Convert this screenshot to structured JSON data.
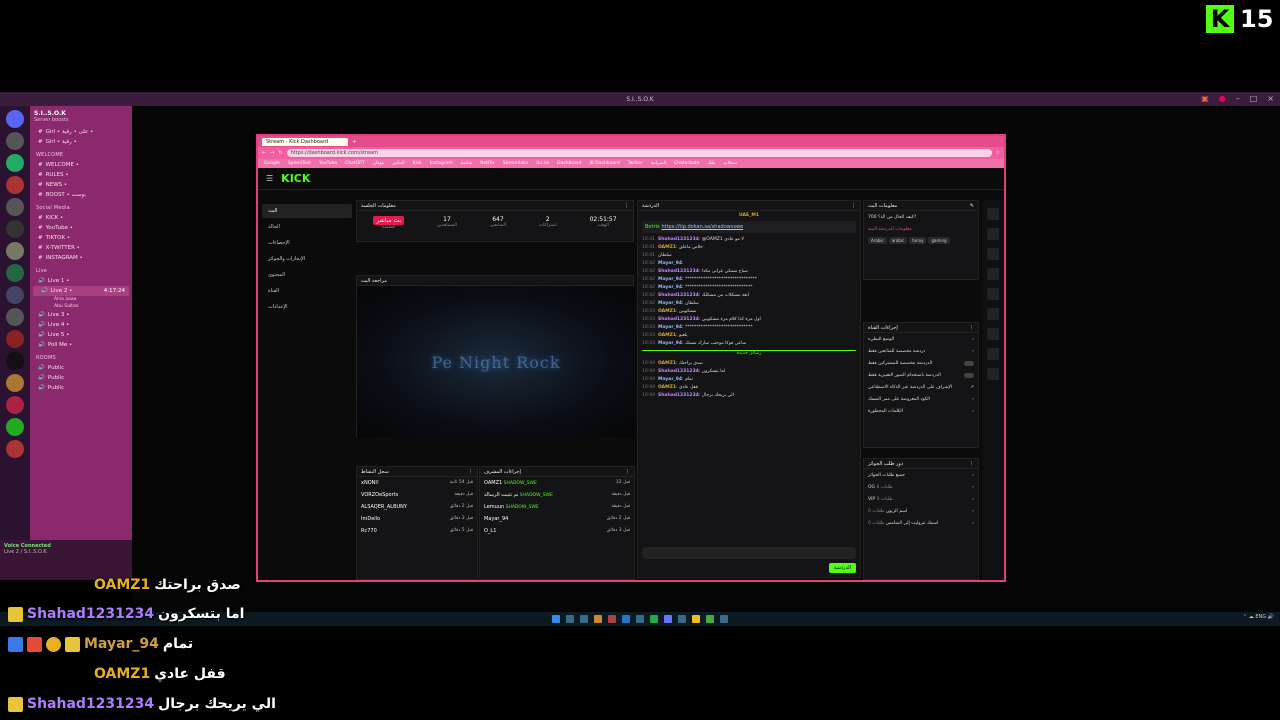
{
  "badge": {
    "logo": "K",
    "count": "15"
  },
  "discord": {
    "window_title": "S.I..S.O.K",
    "server_name": "S.I..S.O.K",
    "server_sub": "Server boosts",
    "channels": [
      {
        "label": "Girl • على • رقية •",
        "type": "text"
      },
      {
        "label": "Girl • رقية •",
        "type": "text"
      }
    ],
    "categories": [
      "WELCOME",
      "Social Media",
      "Live",
      "ROOMS"
    ],
    "welcome_channels": [
      "WELCOME •",
      "RULES •",
      "NEWS •",
      "BOOST • بوست"
    ],
    "social_channels": [
      "KICK •",
      "YouTube •",
      "TIKTOK •",
      "X-TWITTER •",
      "INSTAGRAM •"
    ],
    "live_channels": [
      "Live 1 •",
      "Live 2 •",
      "Live 3 •",
      "Live 4 •",
      "Live 5 •",
      "Poll Me •"
    ],
    "live2_time": "4:17:24",
    "live2_users": [
      "Alna aaaa",
      "Abu Sultan"
    ],
    "rooms": [
      "Public",
      "Public",
      "Public"
    ],
    "voice_status": "Voice Connected",
    "voice_sub": "Live 2 / S.I..S.O.K"
  },
  "browser": {
    "tab_label": "Stream - Kick Dashboard",
    "url": "https://dashboard.kick.com/stream",
    "bookmarks": [
      "Google",
      "SpeedTest",
      "YouTube",
      "ChatGPT",
      "بنوفان",
      "التباس",
      "Kick",
      "Instagram",
      "شاشة",
      "Netflix",
      "Streamlabs",
      "ikz.sa",
      "Dashboard",
      "JB Dashboard",
      "Twitter",
      "الميزانية",
      "Chaturbate",
      "ملك",
      "سجلات"
    ]
  },
  "kick": {
    "logo": "KICK",
    "nav": [
      "البث",
      "الحالة",
      "الإحصاءات",
      "الإنجازات والجوائز",
      "المحتوى",
      "القناة",
      "الإعدادات"
    ],
    "stats_title": "معلومات الجلسة",
    "stats": [
      {
        "value": "بث مباشر",
        "label": "الجلسة"
      },
      {
        "value": "17",
        "label": "المشاهدين"
      },
      {
        "value": "647",
        "label": "المتابعين"
      },
      {
        "value": "2",
        "label": "اشتراكات"
      },
      {
        "value": "02:51:57",
        "label": "الوقت"
      }
    ],
    "preview_title": "مراجعة البث",
    "preview_watermark": "Pe Night Rock",
    "follows_title": "سجل النشاط",
    "follows": [
      {
        "name": "xNONI!",
        "time": "قبل 54 ثانية"
      },
      {
        "name": "VORZOeSports",
        "time": "قبل دقيقة"
      },
      {
        "name": "ALSAQER_ALBUNY",
        "time": "قبل 2 دقائق"
      },
      {
        "name": "ImDello",
        "time": "قبل 3 دقائق"
      },
      {
        "name": "Rc770",
        "time": "قبل 5 دقائق"
      }
    ],
    "events_title": "إجراءات المشرف",
    "events": [
      {
        "name": "OAMZ1",
        "detail": "SHADOW_SWE",
        "time": "قبل 12"
      },
      {
        "name": "تم تثبيت الرسالة",
        "detail": "SHADOW_SWE",
        "time": "قبل دقيقة"
      },
      {
        "name": "Lemuun",
        "detail": "SHADOW_SWE",
        "time": "قبل دقيقة"
      },
      {
        "name": "Mayar_94",
        "detail": "",
        "time": "قبل 2 دقائق"
      },
      {
        "name": "O_L1",
        "detail": "",
        "time": "قبل 3 دقائق"
      }
    ],
    "chat_title": "الدردشة",
    "chat_host": "UAE_M1",
    "pinned_user": "Botrix",
    "pinned_link": "https://tip.dokan.sa/shadowsswe",
    "chat": [
      {
        "time": "10:41",
        "user": "Shahad1231234",
        "cls": "sha",
        "text": "@OAMZ1 لا مو عادي"
      },
      {
        "time": "10:41",
        "user": "OAMZ1",
        "cls": "oamz",
        "text": "خلاص ماعلق"
      },
      {
        "time": "10:41",
        "user": "",
        "cls": "",
        "text": "سلطان"
      },
      {
        "time": "10:42",
        "user": "Mayar_94",
        "cls": "may",
        "text": ""
      },
      {
        "time": "10:42",
        "user": "Shahad1231234",
        "cls": "sha",
        "text": "صباح مشكي عزانى مكذا"
      },
      {
        "time": "10:42",
        "user": "Mayar_94",
        "cls": "may",
        "text": "********************************"
      },
      {
        "time": "10:42",
        "user": "Mayar_94",
        "cls": "may",
        "text": "******************************"
      },
      {
        "time": "10:42",
        "user": "Shahad1231234",
        "cls": "sha",
        "text": "ابغة مشكلات من مشكلك"
      },
      {
        "time": "10:42",
        "user": "Mayar_94",
        "cls": "may",
        "text": "سلطان"
      },
      {
        "time": "10:43",
        "user": "OAMZ1",
        "cls": "oamz",
        "text": "مشكوبين"
      },
      {
        "time": "10:43",
        "user": "Shahad1231234",
        "cls": "sha",
        "text": "اول مره كذا كلام مره مشكوبين"
      },
      {
        "time": "10:43",
        "user": "Mayar_94",
        "cls": "may",
        "text": "******************************"
      },
      {
        "time": "10:43",
        "user": "OAMZ1",
        "cls": "oamz",
        "text": "يلعبو"
      },
      {
        "time": "10:43",
        "user": "Mayar_94",
        "cls": "may",
        "text": "ساعي فوكا موحنب سارك مسنك"
      },
      {
        "time": "10:44",
        "user": "OAMZ1",
        "cls": "oamz",
        "text": "صدق براحتك"
      },
      {
        "time": "10:44",
        "user": "Shahad1231234",
        "cls": "sha",
        "text": "اما بتسكرون"
      },
      {
        "time": "10:44",
        "user": "Mayar_94",
        "cls": "may",
        "text": "تمام"
      },
      {
        "time": "10:44",
        "user": "OAMZ1",
        "cls": "oamz",
        "text": "قفل عادي"
      },
      {
        "time": "10:44",
        "user": "Shahad1231234",
        "cls": "sha",
        "text": "الي يريحك برجال"
      }
    ],
    "chat_separator": "رسائل جديدة",
    "send_label": "الدردشة",
    "info_title": "معلومات البث",
    "info_stream_title": "كيف الحال من الذ؟ 700?",
    "info_category": "معلومات الدردشة المتة",
    "info_tags": [
      "Arabic",
      "arabic",
      "funny",
      "gaming"
    ],
    "actions_title": "إجراءات القناة",
    "actions": [
      "الوضع البطيء",
      "دردشة مخصصة للمتابعين فقط",
      "الدردشة مخصصة للمشتركين فقط",
      "الدردشة باستخدام الصور التعبيرية فقط",
      "الإشراف على الدردشة عبر الذكاء الاصطناعي",
      "الكود المعروضة على ممر المسك",
      "الكلمات المحظورة"
    ],
    "rewards_title": "دور طلب الجوائز",
    "rewards": [
      {
        "name": "جميع طلبات الجوائز",
        "sub": ""
      },
      {
        "name": "OG",
        "sub": "طلبات 0"
      },
      {
        "name": "VIP",
        "sub": "طلبات 0"
      },
      {
        "name": "اسم الزيون",
        "sub": "طلبات 0"
      },
      {
        "name": "اسمك نثروليت إلى الشامس",
        "sub": "طلبات 0"
      }
    ]
  },
  "overlay_chat": [
    {
      "user": "OAMZ1",
      "text": "صدق براحتك",
      "color": "#e8b020",
      "icons": []
    },
    {
      "user": "Shahad1231234",
      "text": "اما بتسكرون",
      "color": "#b07cff",
      "icons": [
        "yl"
      ]
    },
    {
      "user": "Mayar_94",
      "text": "تمام",
      "color": "#d0a040",
      "icons": [
        "bl",
        "rd",
        "gd",
        "yl"
      ]
    },
    {
      "user": "OAMZ1",
      "text": "قفل عادي",
      "color": "#e8b020",
      "icons": []
    },
    {
      "user": "Shahad1231234",
      "text": "الي يريحك برجال",
      "color": "#b07cff",
      "icons": [
        "yl"
      ]
    }
  ]
}
